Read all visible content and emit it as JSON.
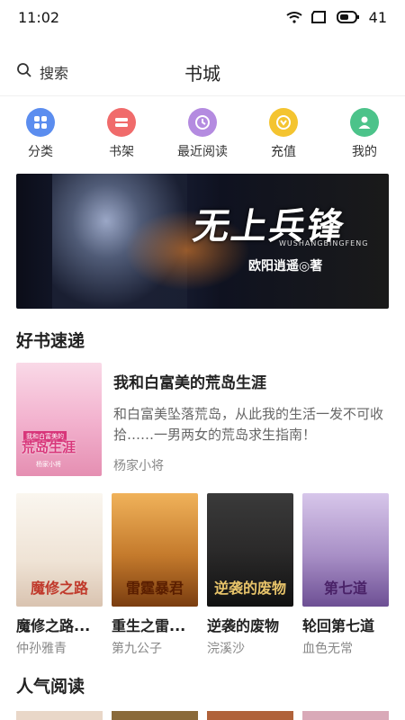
{
  "status": {
    "time": "11:02",
    "battery": "41"
  },
  "header": {
    "search_label": "搜索",
    "title": "书城"
  },
  "nav": [
    {
      "label": "分类",
      "icon": "grid-icon",
      "color": "#5b8def"
    },
    {
      "label": "书架",
      "icon": "shelf-icon",
      "color": "#f06b6b"
    },
    {
      "label": "最近阅读",
      "icon": "clock-icon",
      "color": "#b48be0"
    },
    {
      "label": "充值",
      "icon": "recharge-icon",
      "color": "#f4c430"
    },
    {
      "label": "我的",
      "icon": "user-icon",
      "color": "#4cc38a"
    }
  ],
  "banner": {
    "title": "无上兵锋",
    "subtitle": "WUSHANGBINGFENG",
    "author": "欧阳逍遥◎著"
  },
  "sections": {
    "fast_books": "好书速递",
    "popular": "人气阅读"
  },
  "featured": {
    "title": "我和白富美的荒岛生涯",
    "description": "和白富美坠落荒岛，从此我的生活一发不可收拾……一男两女的荒岛求生指南！",
    "author": "杨家小将",
    "cover_text": "荒岛生涯",
    "cover_top": "我和白富美的",
    "cover_author": "杨家小将"
  },
  "books": [
    {
      "title": "魔修之路...",
      "author": "仲孙雅青",
      "cover_text": "魔修之路",
      "cover_color": "#f5efe6",
      "text_color": "#c0392b"
    },
    {
      "title": "重生之雷...",
      "author": "第九公子",
      "cover_text": "雷霆暴君",
      "cover_color": "#c47a2c",
      "text_color": "#5a1e00"
    },
    {
      "title": "逆袭的废物",
      "author": "浣溪沙",
      "cover_text": "逆袭的废物",
      "cover_color": "#2b2a2a",
      "text_color": "#e8c46a"
    },
    {
      "title": "轮回第七道",
      "author": "血色无常",
      "cover_text": "第七道",
      "cover_color": "#a88fc6",
      "text_color": "#4a2268"
    }
  ]
}
